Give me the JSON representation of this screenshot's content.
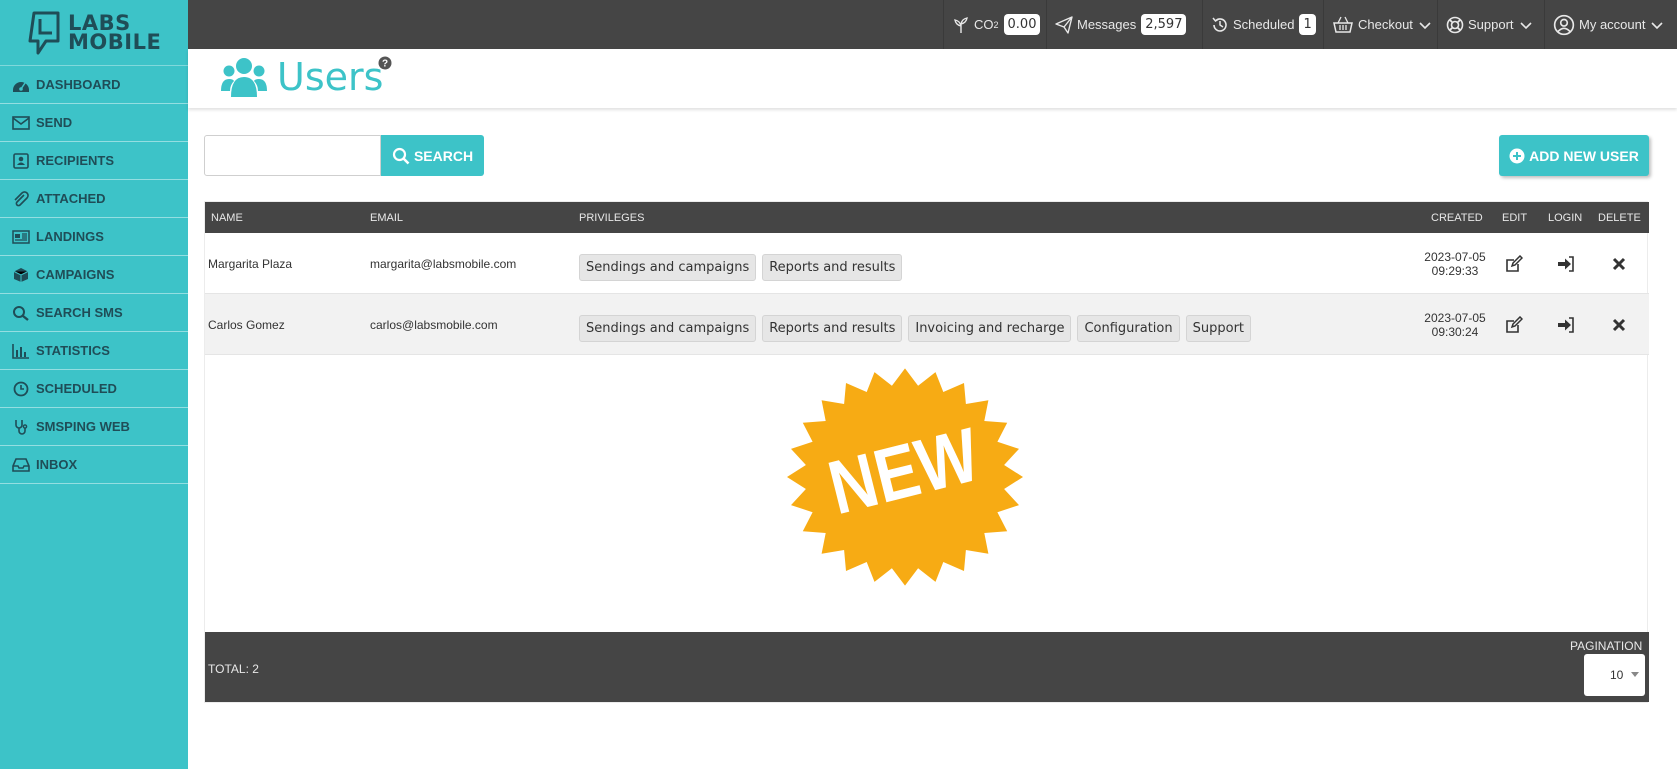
{
  "app": {
    "logo_line1": "LABS",
    "logo_line2": "MOBILE",
    "accent_color": "#3dc3c8",
    "dark_color": "#454545"
  },
  "sidebar": {
    "items": [
      {
        "label": "DASHBOARD",
        "icon": "dashboard-icon"
      },
      {
        "label": "SEND",
        "icon": "envelope-icon"
      },
      {
        "label": "RECIPIENTS",
        "icon": "contact-card-icon"
      },
      {
        "label": "ATTACHED",
        "icon": "paperclip-icon"
      },
      {
        "label": "LANDINGS",
        "icon": "newspaper-icon"
      },
      {
        "label": "CAMPAIGNS",
        "icon": "cube-icon"
      },
      {
        "label": "SEARCH SMS",
        "icon": "search-icon"
      },
      {
        "label": "STATISTICS",
        "icon": "bar-chart-icon"
      },
      {
        "label": "SCHEDULED",
        "icon": "clock-icon"
      },
      {
        "label": "SMSPING WEB",
        "icon": "stethoscope-icon"
      },
      {
        "label": "INBOX",
        "icon": "inbox-icon"
      }
    ]
  },
  "topbar": {
    "co2_label": "CO",
    "co2_sub": "2",
    "co2_value": "0.00",
    "messages_label": "Messages",
    "messages_value": "2,597",
    "scheduled_label": "Scheduled",
    "scheduled_value": "1",
    "checkout_label": "Checkout",
    "support_label": "Support",
    "account_label": "My account"
  },
  "header": {
    "title": "Users",
    "help": "?"
  },
  "search": {
    "placeholder": "",
    "button_label": "SEARCH"
  },
  "add_button_label": "ADD NEW USER",
  "table": {
    "columns": [
      "NAME",
      "EMAIL",
      "PRIVILEGES",
      "CREATED",
      "EDIT",
      "LOGIN",
      "DELETE"
    ],
    "rows": [
      {
        "name": "Margarita Plaza",
        "email": "margarita@labsmobile.com",
        "privileges": [
          "Sendings and campaigns",
          "Reports and results"
        ],
        "created_date": "2023-07-05",
        "created_time": "09:29:33"
      },
      {
        "name": "Carlos Gomez",
        "email": "carlos@labsmobile.com",
        "privileges": [
          "Sendings and campaigns",
          "Reports and results",
          "Invoicing and recharge",
          "Configuration",
          "Support"
        ],
        "created_date": "2023-07-05",
        "created_time": "09:30:24"
      }
    ],
    "total_label": "TOTAL: 2",
    "pagination_label": "PAGINATION",
    "pagination_value": "10"
  },
  "badge": {
    "text": "NEW",
    "color": "#f7ab14"
  }
}
